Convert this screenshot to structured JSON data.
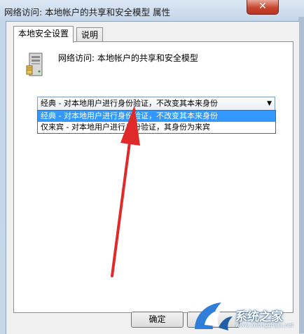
{
  "window": {
    "title": "网络访问: 本地帐户的共享和安全模型 属性",
    "close_label": "✕"
  },
  "tabs": [
    {
      "label": "本地安全设置"
    },
    {
      "label": "说明"
    }
  ],
  "policy": {
    "name": "网络访问: 本地帐户的共享和安全模型",
    "icon": "server-icon"
  },
  "combo": {
    "selected": "经典 - 对本地用户进行身份验证，不改变其本来身份",
    "arrow": "▼",
    "options": [
      "经典 - 对本地用户进行身份验证，不改变其本来身份",
      "仅来宾 - 对本地用户进行身份验证，其身份为来宾"
    ]
  },
  "buttons": {
    "ok_label": "确定"
  },
  "watermark": {
    "text": "系统之家",
    "url": "www.xitongzhijia.net"
  },
  "colors": {
    "selection": "#3399ff",
    "annotation_arrow": "#e02a2a"
  }
}
